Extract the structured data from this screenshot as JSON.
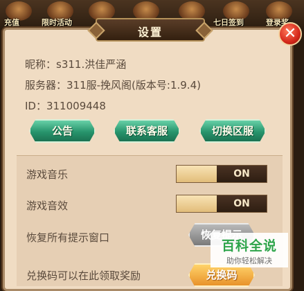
{
  "topbar": {
    "labels": [
      "充值",
      "限时活动",
      "",
      "",
      "",
      "七日签到",
      "登录奖"
    ]
  },
  "dialog": {
    "title": "设置",
    "close_symbol": "✕"
  },
  "account": {
    "nickname": "昵称：s311.洪佳严涵",
    "server": "服务器：311服-挽风阁(版本号:1.9.4)",
    "id": "ID：311009448"
  },
  "buttons": {
    "notice": "公告",
    "contact": "联系客服",
    "switch_server": "切换区服",
    "restore": "恢复提示",
    "redeem": "兑换码"
  },
  "settings": {
    "music_label": "游戏音乐",
    "music_state": "ON",
    "sfx_label": "游戏音效",
    "sfx_state": "ON",
    "restore_label": "恢复所有提示窗口",
    "redeem_label": "兑换码可以在此领取奖励"
  },
  "watermark": {
    "main": "百科全说",
    "sub": "助你轻松解决"
  },
  "colors": {
    "panel_bg": "#f0dcc3",
    "green_button": "#27946c",
    "toggle_on": "#2e1e12",
    "close_red": "#d5281b"
  }
}
